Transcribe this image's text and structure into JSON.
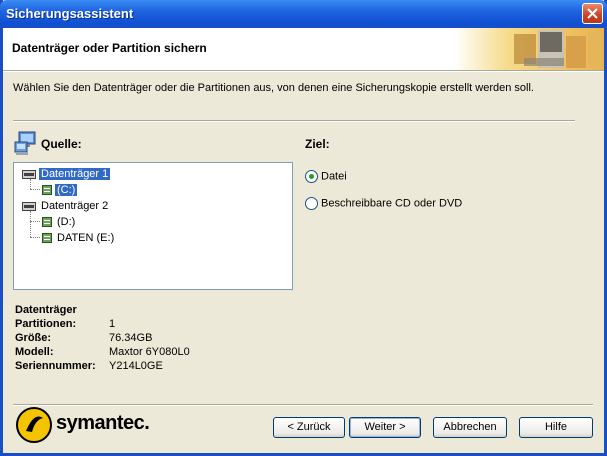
{
  "window": {
    "title": "Sicherungsassistent"
  },
  "header": {
    "heading": "Datenträger oder Partition sichern"
  },
  "description": "Wählen Sie den Datenträger oder die Partitionen aus, von denen eine Sicherungskopie erstellt werden soll.",
  "source": {
    "label": "Quelle:",
    "tree": [
      {
        "label": "Datenträger 1",
        "type": "disk",
        "selected": true
      },
      {
        "label": "(C:)",
        "type": "partition",
        "selected": true
      },
      {
        "label": "Datenträger 2",
        "type": "disk",
        "selected": false
      },
      {
        "label": "(D:)",
        "type": "partition",
        "selected": false
      },
      {
        "label": "DATEN (E:)",
        "type": "partition",
        "selected": false
      }
    ]
  },
  "destination": {
    "label": "Ziel:",
    "options": [
      {
        "label": "Datei",
        "checked": true
      },
      {
        "label": "Beschreibbare CD oder DVD",
        "checked": false
      }
    ]
  },
  "info": {
    "title": "Datenträger",
    "rows": [
      {
        "key": "Partitionen:",
        "value": "1"
      },
      {
        "key": "Größe:",
        "value": "76.34GB"
      },
      {
        "key": "Modell:",
        "value": "Maxtor 6Y080L0"
      },
      {
        "key": "Seriennummer:",
        "value": "Y214L0GE"
      }
    ]
  },
  "brand": {
    "name": "symantec."
  },
  "buttons": {
    "back": "< Zurück",
    "next": "Weiter >",
    "cancel": "Abbrechen",
    "help": "Hilfe"
  },
  "colors": {
    "titlebar": "#1f63e0",
    "selection": "#316ac5",
    "dialog_bg": "#ece9d8"
  }
}
